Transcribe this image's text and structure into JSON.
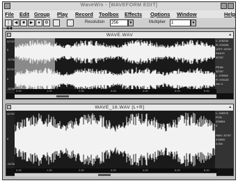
{
  "window": {
    "title": "WaveWin - [WAVEFORM EDIT]"
  },
  "menu": [
    "File",
    "Edit",
    "Group",
    "Play",
    "Record",
    "Toolbox",
    "Effects",
    "Options",
    "Window",
    "Help"
  ],
  "toolbar": {
    "buttons": [
      "|◀◀",
      "◀",
      "■",
      "▶",
      "●",
      "⚙"
    ],
    "resolution_label": "Resolution",
    "resolution_value": "256",
    "multiplier_label": "Multiplier",
    "multiplier_value": "1"
  },
  "panels": [
    {
      "title": "WAVE.WAV",
      "ruler": [
        "32767",
        "0",
        "-32768",
        "32767",
        "0",
        "-32768"
      ],
      "info": [
        "L: 476236",
        "R: 476236",
        "LEFT: 32767",
        "RIGHT: 32767",
        "PEAK: 32767",
        "L: 475962",
        "R: 476128",
        "Sel: 0"
      ],
      "timeline": [
        "0.00",
        "1.00",
        "2.00",
        "3.00",
        "4.00",
        "5.00",
        "6.00"
      ],
      "channels": 2
    },
    {
      "title": "WAVE_16.WAV [L+R]",
      "ruler": [
        "32767",
        "0",
        "-32768"
      ],
      "info": [
        "L: 226976",
        "POS: 228854",
        "0",
        "RMS: 32767",
        "476592",
        "0.000"
      ],
      "timeline": [
        "0.00",
        "1.00",
        "2.00",
        "3.00",
        "4.00",
        "5.00",
        "6.00"
      ],
      "channels": 1
    }
  ],
  "colors": {
    "waveform": "#f2f2f2",
    "background": "#141414",
    "selection": "#8a8a8a"
  }
}
